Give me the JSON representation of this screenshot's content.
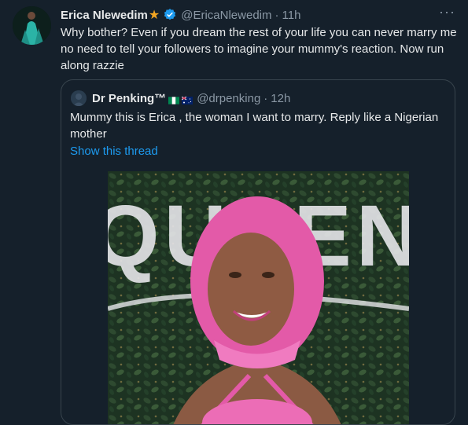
{
  "tweet": {
    "display_name": "Erica Nlewedim",
    "handle": "@EricaNlewedim",
    "time": "11h",
    "text": "Why bother? Even if you dream the rest of your life you can never marry me no need to tell your followers to imagine your mummy's reaction. Now run along razzie",
    "icons": [
      "star-icon",
      "verified-icon",
      "more-icon"
    ]
  },
  "quote": {
    "display_name": "Dr Penking™",
    "handle": "@drpenking",
    "time": "12h",
    "text": "Mummy this is Erica , the woman I want to marry. Reply like a Nigerian mother",
    "show_thread": "Show this thread",
    "flags": [
      "nigeria-flag-icon",
      "australia-flag-icon"
    ],
    "media_text": "QUEEN"
  },
  "colors": {
    "background": "#15202b",
    "text": "#e7e9ea",
    "muted": "#8b98a5",
    "link": "#1d9bf0",
    "border": "#38444d"
  }
}
